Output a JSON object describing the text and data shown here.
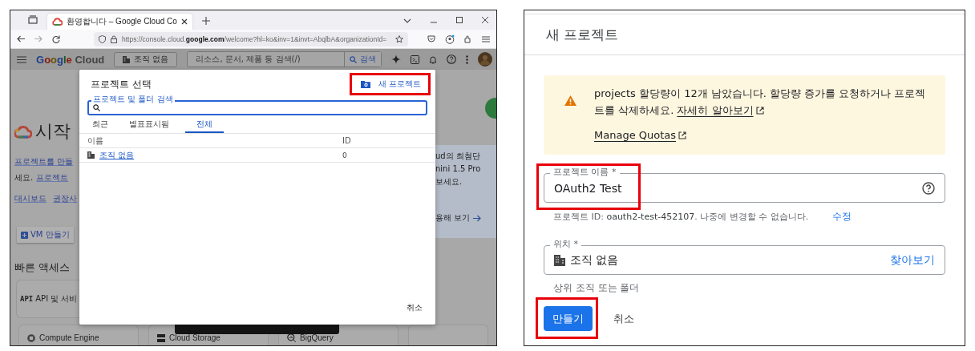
{
  "left_screenshot": {
    "browser": {
      "tab_title": "환영합니다 – Google Cloud Co",
      "url": "https://console.cloud.**google.com**/welcome?hl=ko&inv=1&invt=AbqlbA&organizationId="
    },
    "console_header": {
      "logo_word": "Google",
      "logo_suffix": "Cloud",
      "org_button": "조직 없음",
      "search_placeholder": "리소스, 문서, 제품 등 검색(/)",
      "search_button": "검색"
    },
    "page": {
      "heading": "시작",
      "intro_link": "프로젝트를 만들",
      "intro_text": "세요.",
      "intro_link2": "프로젝트",
      "links": [
        "대시보드",
        "권장사"
      ],
      "vm_button": "VM 만들기",
      "quick_access_title": "빠른 액세스",
      "api_card": {
        "icon": "API",
        "label": "API 및 서비"
      },
      "products": [
        "Compute Engine",
        "Cloud Storage",
        "BigQuery"
      ],
      "promo_lines": [
        "ud의 최첨단",
        "nini 1.5 Pro",
        "보세요."
      ],
      "promo_link": "용해 보기"
    },
    "dialog": {
      "title": "프로젝트 선택",
      "new_project": {
        "label": "새 프로젝트",
        "highlighted": true
      },
      "search_label": "프로젝트 및 폴더 검색",
      "tabs": [
        {
          "label": "최근",
          "selected": false
        },
        {
          "label": "별표표시됨",
          "selected": false
        },
        {
          "label": "전체",
          "selected": true
        }
      ],
      "table": {
        "columns": [
          "이름",
          "ID"
        ],
        "rows": [
          {
            "name": "조직 없음",
            "id": "0"
          }
        ]
      },
      "cancel": "취소"
    }
  },
  "right_screenshot": {
    "title": "새 프로젝트",
    "notice": {
      "text": "projects 할당량이 12개 남았습니다. 할당량 증가를 요청하거나 프로젝트를 삭제하세요.",
      "link": "자세히 알아보기",
      "link2": "Manage Quotas"
    },
    "name_field": {
      "label": "프로젝트 이름 *",
      "value": "OAuth2 Test",
      "highlighted": true
    },
    "project_id_hint": "프로젝트 ID: **oauth2-test-452107**. 나중에 변경할 수 없습니다.",
    "edit_link": "수정",
    "location_field": {
      "label": "위치 *",
      "value": "조직 없음",
      "browse": "찾아보기"
    },
    "location_hint": "상위 조직 또는 폴더",
    "create_button": {
      "label": "만들기",
      "highlighted": true
    },
    "cancel_button": "취소"
  }
}
